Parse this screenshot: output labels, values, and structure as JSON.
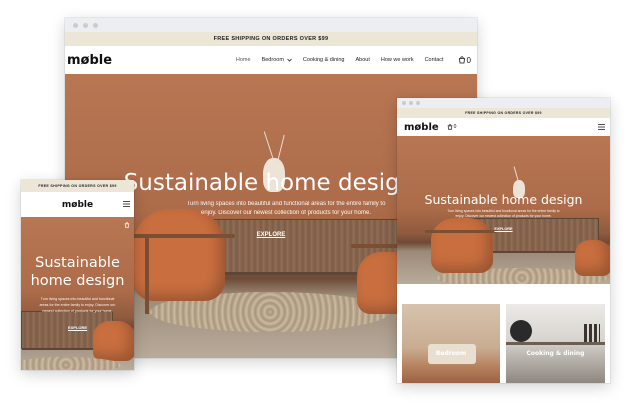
{
  "banner": "FREE SHIPPING ON ORDERS OVER $99",
  "logo": "møble",
  "nav": {
    "home": "Home",
    "bedroom": "Bedroom",
    "cooking": "Cooking & dining",
    "about": "About",
    "how": "How we work",
    "contact": "Contact"
  },
  "cart_count": "0",
  "hero": {
    "title": "Sustainable home design",
    "subtitle_line1": "Turn living spaces into beautiful and functional areas for the entire family to",
    "subtitle_line2": "enjoy. Discover our newest collection of products for your home.",
    "cta": "EXPLORE"
  },
  "tablet": {
    "title": "Sustainable home design",
    "subtitle_line1": "Turn living spaces into beautiful and functional areas for the entire family to",
    "subtitle_line2": "enjoy. Discover our newest collection of products for your home.",
    "cta": "EXPLORE",
    "tiles": [
      "Bedroom",
      "Cooking & dining"
    ]
  },
  "mobile": {
    "title_line1": "Sustainable",
    "title_line2": "home design",
    "subtitle_line1": "Turn living spaces into beautiful and functional",
    "subtitle_line2": "areas for the entire family to enjoy. Discover our",
    "subtitle_line3": "newest collection of products for your home.",
    "cta": "EXPLORE"
  },
  "icons": {
    "cart": "shopping-bag-icon",
    "menu": "hamburger-menu-icon",
    "dropdown": "chevron-down-icon"
  },
  "colors": {
    "hero_bg": "#b87653",
    "banner_bg": "#ece6d7",
    "chair": "#c86e3f"
  }
}
